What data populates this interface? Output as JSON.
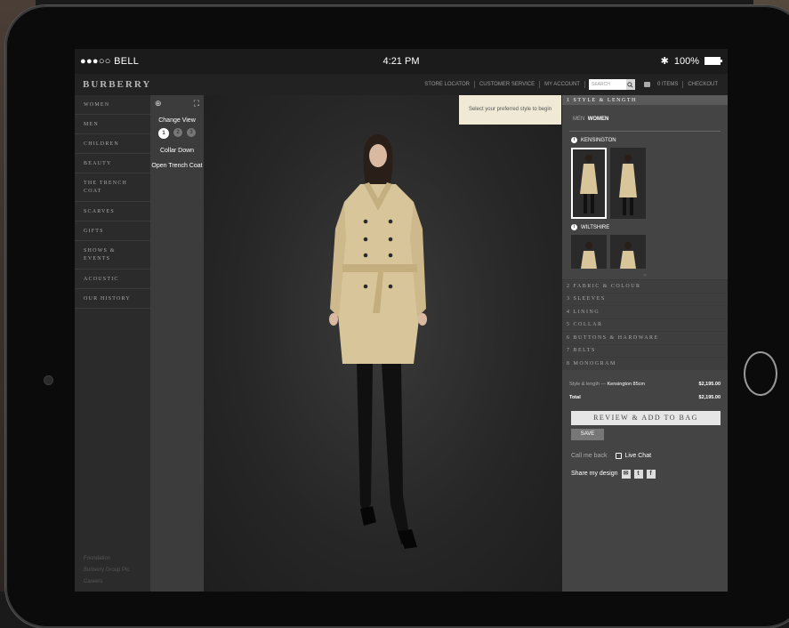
{
  "status": {
    "carrier": "●●●○○ BELL",
    "time": "4:21 PM",
    "battery": "100%"
  },
  "brand": "BURBERRY",
  "topnav": {
    "store_locator": "STORE LOCATOR",
    "customer_service": "CUSTOMER SERVICE",
    "my_account": "MY ACCOUNT",
    "search_placeholder": "SEARCH",
    "bag": "0 ITEMS",
    "checkout": "CHECKOUT"
  },
  "menu": {
    "items": [
      "WOMEN",
      "MEN",
      "CHILDREN",
      "BEAUTY",
      "THE TRENCH COAT",
      "SCARVES",
      "GIFTS",
      "SHOWS & EVENTS",
      "ACOUSTIC",
      "OUR HISTORY"
    ],
    "footer": [
      "Foundation",
      "Burberry Group Plc",
      "Careers"
    ]
  },
  "tools": {
    "change_view": "Change View",
    "steps": [
      "1",
      "2",
      "3"
    ],
    "collar_down": "Collar Down",
    "open_trench": "Open Trench Coat"
  },
  "tooltip": "Select your preferred style to begin",
  "panel": {
    "header": "1  STYLE & LENGTH",
    "gender_men": "MEN",
    "gender_women": "WOMEN",
    "style1": "KENSINGTON",
    "style2": "WILTSHIRE",
    "steps": [
      "2  FABRIC & COLOUR",
      "3  SLEEVES",
      "4  LINING",
      "5  COLLAR",
      "6  BUTTONS & HARDWARE",
      "7  BELTS",
      "8  MONOGRAM"
    ],
    "line_label": "Style & length — ",
    "line_value": "Kensington 85cm",
    "line_price": "$2,195.00",
    "total_label": "Total",
    "total_price": "$2,195.00",
    "review": "REVIEW & ADD TO BAG",
    "save": "SAVE",
    "call": "Call me back",
    "chat": "Live Chat",
    "share": "Share my design"
  },
  "colors": {
    "trench": "#d8c69a",
    "panel_bg": "#444444",
    "tooltip_bg": "#efe9d6"
  }
}
